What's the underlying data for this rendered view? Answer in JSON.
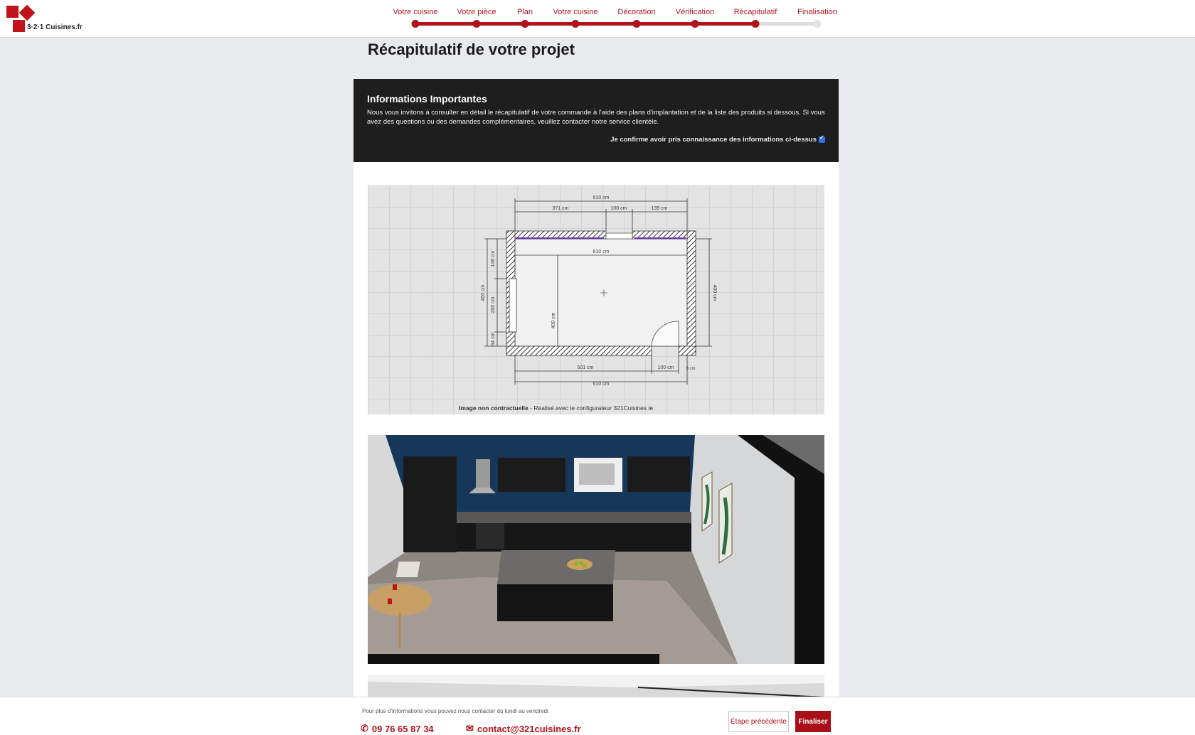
{
  "brand": {
    "logo_text": "3·2·1 Cuisines.fr",
    "accent": "#b0141a"
  },
  "steps": [
    {
      "label": "Votre cuisine",
      "done": true
    },
    {
      "label": "Votre pièce",
      "done": true
    },
    {
      "label": "Plan",
      "done": true
    },
    {
      "label": "Votre cuisine",
      "done": true
    },
    {
      "label": "Décoration",
      "done": true
    },
    {
      "label": "Vérification",
      "done": true
    },
    {
      "label": "Récapitulatif",
      "done": true,
      "current": true
    },
    {
      "label": "Finalisation",
      "done": false
    }
  ],
  "page_title": "Récapitulatif de votre projet",
  "info": {
    "heading": "Informations Importantes",
    "text": "Nous vous invitons à consulter en détail le récapitulatif de votre commande à l'aide des plans d'implantation et de la liste des produits si dessous. Si vous avez des questions ou des demandes complémentaires, veuillez contacter notre service clientèle.",
    "confirm_label": "Je confirme avoir pris connaissance des informations ci-dessus",
    "confirm_checked": true
  },
  "plan": {
    "dims": {
      "top_total": "610 cm",
      "seg1": "371 cm",
      "seg2": "100 cm",
      "seg3": "139 cm",
      "inner_width": "610 cm",
      "left_total": "400 cm",
      "left_seg1": "136 cm",
      "left_seg2": "200 cm",
      "left_seg3": "64 cm",
      "inner_height": "400 cm",
      "right": "400 cm",
      "bottom_seg1": "501 cm",
      "bottom_seg2": "100 cm",
      "bottom_small": "9 cm",
      "bottom_total": "610 cm"
    },
    "caption_bold": "Image non contractuelle",
    "caption_rest": " - Réalisé avec le configurateur 321Cuisines le"
  },
  "footer": {
    "note": "Pour plus d'informations vous pouvez nous contacter du lundi au vendredi",
    "phone": "09 76 65 87 34",
    "email": "contact@321cuisines.fr",
    "prev_label": "Étape précédente",
    "next_label": "Finaliser"
  }
}
